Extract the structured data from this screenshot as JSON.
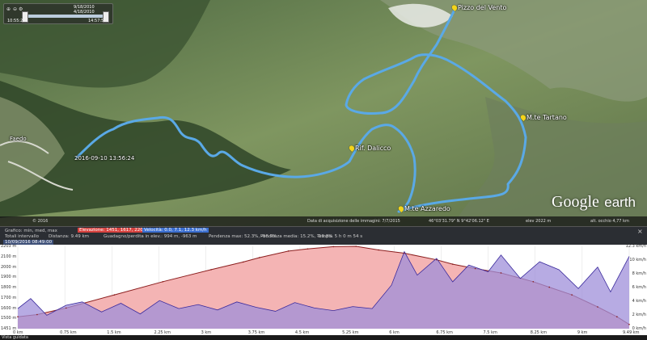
{
  "time_slider": {
    "date_top": "9/18/2010",
    "date_mid": "4/18/2010",
    "start_time": "10:55:2",
    "end_time": "14:57:5"
  },
  "placemarks": {
    "pizzo": "Pizzo del Vento",
    "tartano": "M.te Tartano",
    "dalicco": "Rif. Dalicco",
    "azzaredo": "M.te Azzaredo",
    "start_time": "2016-09-10 13:56:24",
    "village": "Faedo"
  },
  "logo": {
    "google": "Google",
    "earth": "earth"
  },
  "statusbar": {
    "left": "© 2016",
    "imagery": "Data di acquisizione delle immagini: 7/7/2015",
    "coords": "46°03'31.79\" N 9°42'06.12\" E",
    "elev": "elev 2022 m",
    "eye": "alt. occhio 4,77 km"
  },
  "elevation_header": {
    "row1_label": "Grafico: min, med, max",
    "elevazione": "Elevazione: 1451, 1617, 2203 m",
    "velocita": "Velocità: 0.0, 7.1, 12.3 km/h",
    "row2_label": "Totali intervallo",
    "distanza": "Distanza: 9.49 km",
    "guadagno": "Guadagno/perdita in elev.: 994 m, -963 m",
    "pendenza_max": "Pendenza max: 52.3%, -56.7%",
    "pendenza_media": "Pendenza media: 15.2%, -19.8%",
    "tempo": "Tempo: 5 h 0 m 54 s",
    "tab": "10/09/2016 08:49:00"
  },
  "chart_data": {
    "type": "area",
    "title": "",
    "y_left_ticks": [
      "2203 m",
      "2100 m",
      "2000 m",
      "1900 m",
      "1800 m",
      "1700 m",
      "1600 m",
      "1500 m",
      "1451 m"
    ],
    "y_right_ticks": [
      "12.3 km/h",
      "10 km/h",
      "8 km/h",
      "6 km/h",
      "4 km/h",
      "2 km/h",
      "0 km/h"
    ],
    "x_ticks": [
      "0 km",
      "0.75 km",
      "1.5 km",
      "2.25 km",
      "3 km",
      "3.75 km",
      "4.5 km",
      "5.25 km",
      "6 km",
      "6.75 km",
      "7.5 km",
      "8.25 km",
      "9 km",
      "9.49 km"
    ],
    "series": [
      {
        "name": "Elevazione",
        "unit": "m",
        "x_km": [
          0,
          0.3,
          0.75,
          1.5,
          2.25,
          3.0,
          3.5,
          3.75,
          4.2,
          4.5,
          4.9,
          5.25,
          5.6,
          6.0,
          6.5,
          6.75,
          7.1,
          7.5,
          8.0,
          8.25,
          8.6,
          9.0,
          9.3,
          9.49
        ],
        "values": [
          1560,
          1580,
          1640,
          1760,
          1880,
          1990,
          2060,
          2100,
          2160,
          2180,
          2200,
          2203,
          2170,
          2140,
          2080,
          2040,
          2000,
          1960,
          1880,
          1830,
          1760,
          1650,
          1560,
          1490
        ]
      },
      {
        "name": "Velocità",
        "unit": "km/h",
        "x_km": [
          0,
          0.2,
          0.45,
          0.75,
          1.0,
          1.3,
          1.6,
          1.9,
          2.2,
          2.5,
          2.8,
          3.1,
          3.4,
          3.7,
          4.0,
          4.3,
          4.6,
          4.9,
          5.2,
          5.5,
          5.8,
          6.0,
          6.2,
          6.5,
          6.75,
          7.0,
          7.3,
          7.5,
          7.8,
          8.1,
          8.4,
          8.7,
          9.0,
          9.2,
          9.49
        ],
        "values": [
          3.0,
          4.5,
          2.0,
          3.5,
          4.0,
          2.5,
          3.8,
          2.2,
          4.2,
          3.0,
          3.6,
          2.8,
          4.0,
          3.2,
          2.6,
          3.9,
          3.1,
          2.7,
          3.3,
          3.0,
          6.5,
          11.5,
          8.0,
          10.5,
          7.0,
          9.5,
          8.5,
          11.0,
          7.5,
          10.0,
          8.8,
          6.0,
          9.2,
          5.5,
          10.8
        ]
      }
    ],
    "ylim_left": [
      1451,
      2203
    ],
    "ylim_right": [
      0,
      12.3
    ],
    "xlim": [
      0,
      9.49
    ],
    "grid": true
  },
  "taskbar": {
    "button": "Vista guidata"
  },
  "colors": {
    "track": "#5aa9e6",
    "elevation_fill": "#f4b4b4",
    "speed_fill": "#9f8fd9",
    "speed_line": "#3a2a9c"
  }
}
